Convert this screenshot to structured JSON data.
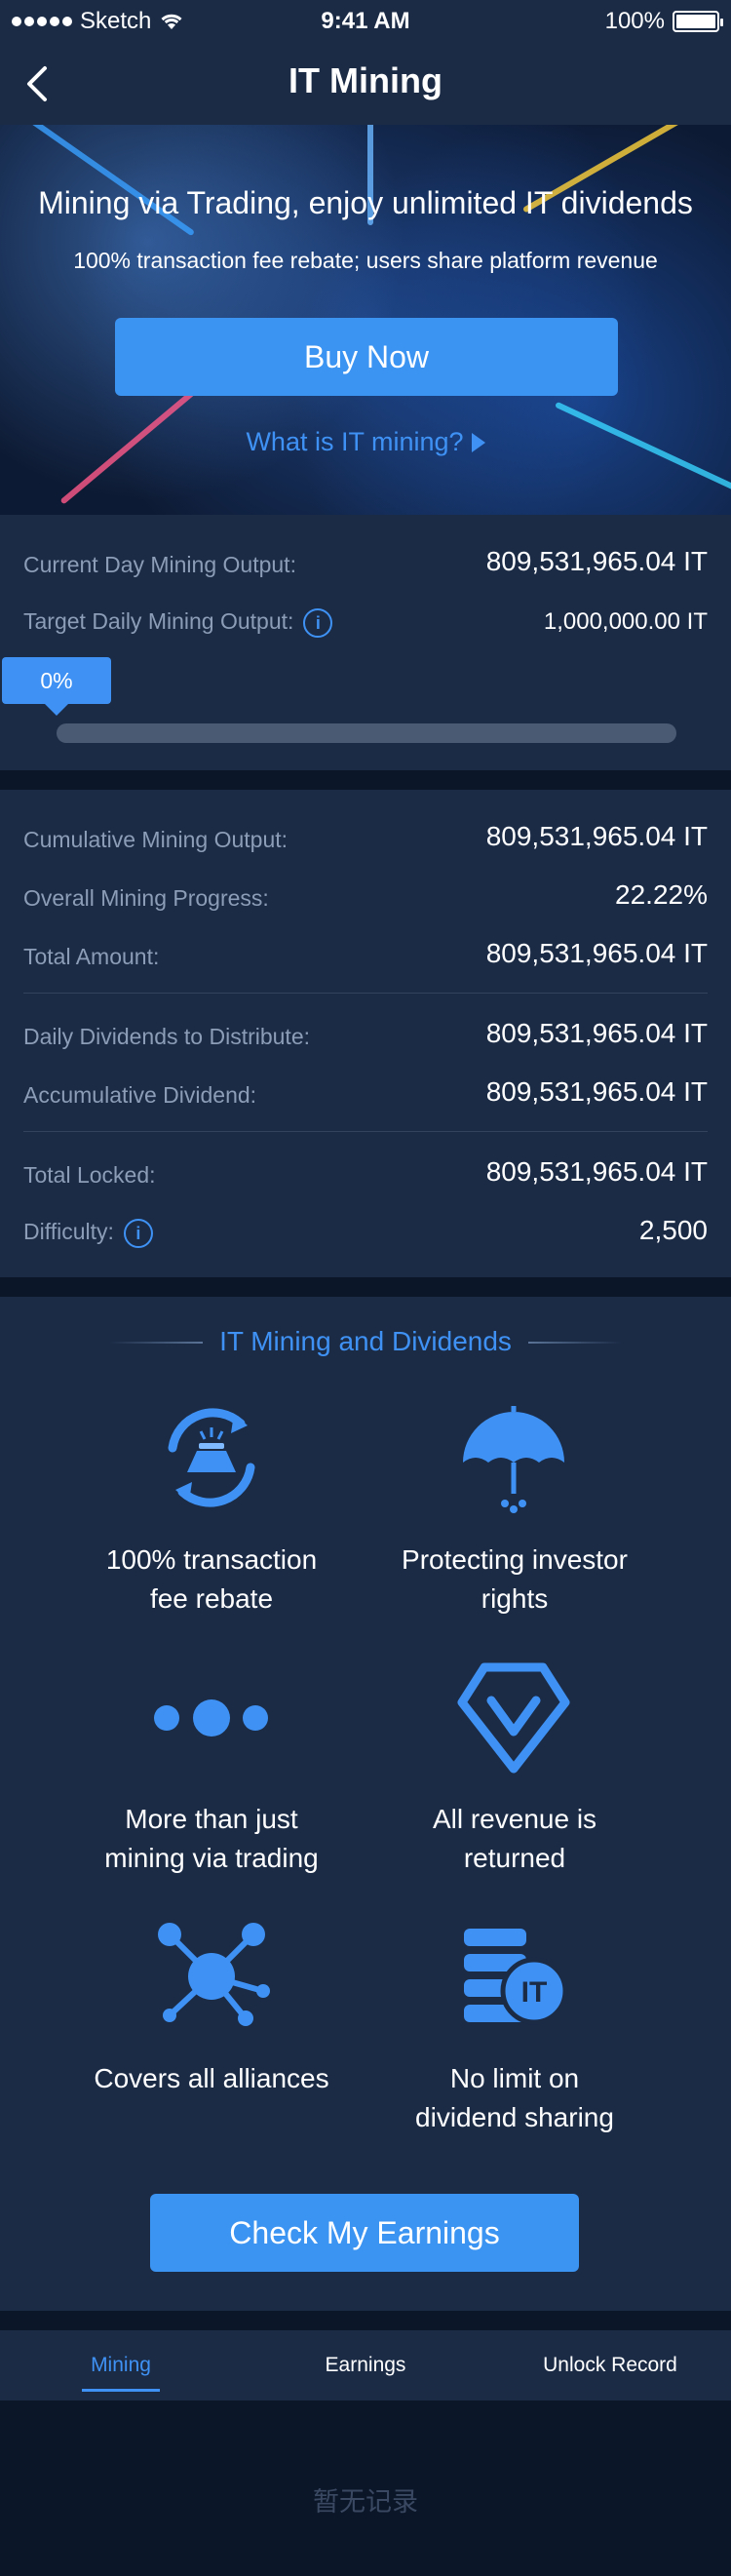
{
  "status_bar": {
    "carrier": "Sketch",
    "time": "9:41 AM",
    "battery": "100%"
  },
  "nav": {
    "title": "IT Mining"
  },
  "hero": {
    "title": "Mining via Trading, enjoy unlimited IT dividends",
    "subtitle": "100% transaction fee rebate; users share platform revenue",
    "buy_label": "Buy Now",
    "link_label": "What is IT mining?"
  },
  "mining_today": {
    "current_label": "Current Day Mining Output:",
    "current_value": "809,531,965.04 IT",
    "target_label": "Target Daily Mining Output:",
    "target_value": "1,000,000.00 IT",
    "progress_label": "0%",
    "progress_fraction": 0
  },
  "stats": {
    "cumulative_label": "Cumulative Mining Output:",
    "cumulative_value": "809,531,965.04 IT",
    "overall_label": "Overall Mining Progress:",
    "overall_value": "22.22%",
    "total_label": "Total Amount:",
    "total_value": "809,531,965.04 IT",
    "daily_div_label": "Daily Dividends to Distribute:",
    "daily_div_value": "809,531,965.04 IT",
    "accum_label": "Accumulative Dividend:",
    "accum_value": "809,531,965.04 IT",
    "locked_label": "Total Locked:",
    "locked_value": "809,531,965.04 IT",
    "difficulty_label": "Difficulty:",
    "difficulty_value": "2,500"
  },
  "features": {
    "title": "IT Mining and Dividends",
    "items": [
      {
        "label": "100% transaction fee rebate",
        "icon": "refresh-gold-icon"
      },
      {
        "label": "Protecting investor rights",
        "icon": "umbrella-icon"
      },
      {
        "label": "More than just mining via trading",
        "icon": "dots-icon"
      },
      {
        "label": "All revenue is returned",
        "icon": "diamond-icon"
      },
      {
        "label": "Covers all alliances",
        "icon": "network-icon"
      },
      {
        "label": "No limit on dividend sharing",
        "icon": "coins-icon"
      }
    ],
    "coin_text": "IT",
    "check_label": "Check My Earnings"
  },
  "tabs": [
    {
      "label": "Mining",
      "active": true
    },
    {
      "label": "Earnings",
      "active": false
    },
    {
      "label": "Unlock Record",
      "active": false
    }
  ],
  "empty_text": "暂无记录",
  "colors": {
    "accent": "#3f92f4",
    "panel": "#1b2b46",
    "background": "#0b1628",
    "muted_text": "#8c9db7"
  }
}
